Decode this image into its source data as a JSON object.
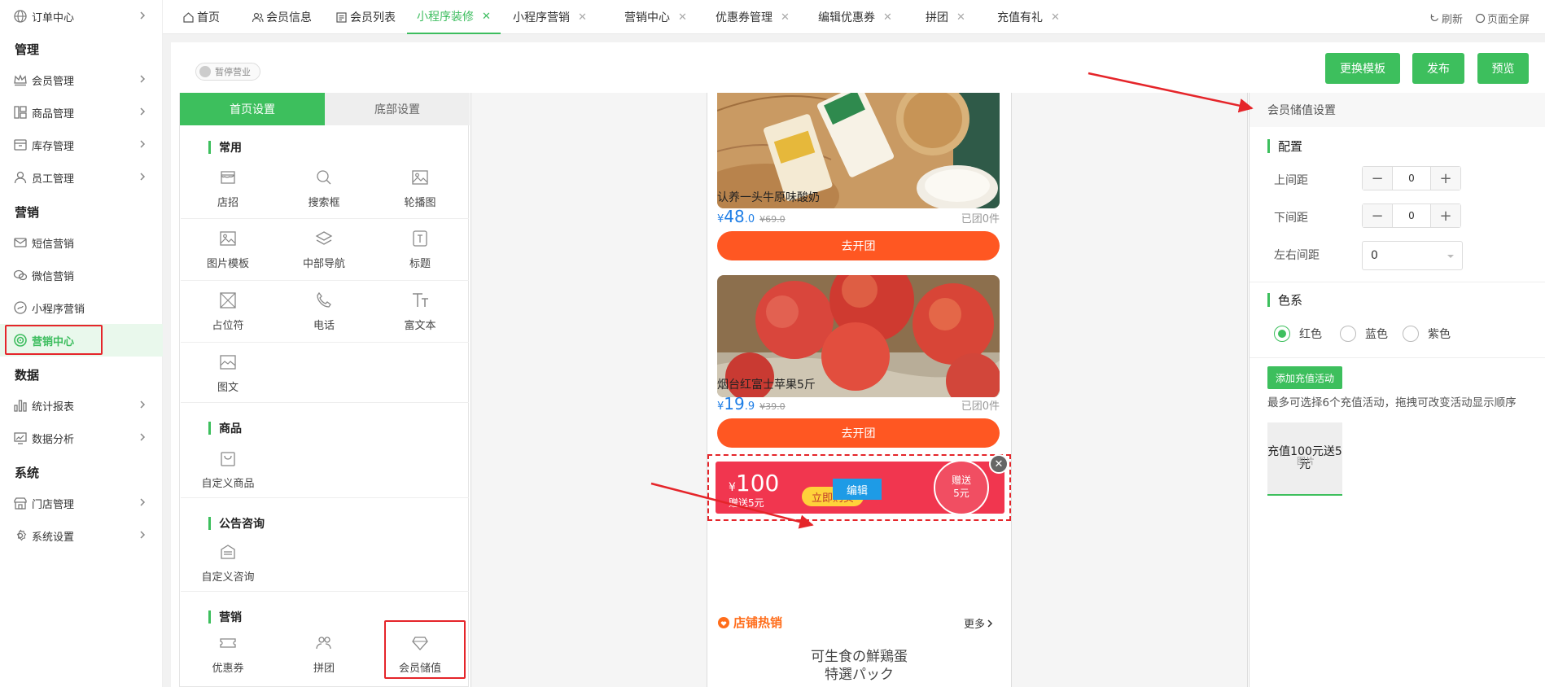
{
  "sidebar": {
    "top_item": "订单中心",
    "groups": [
      "管理",
      "营销",
      "数据",
      "系统"
    ],
    "items": [
      "会员管理",
      "商品管理",
      "库存管理",
      "员工管理",
      "短信营销",
      "微信营销",
      "小程序营销",
      "营销中心",
      "统计报表",
      "数据分析",
      "门店管理",
      "系统设置"
    ]
  },
  "tabs": [
    "首页",
    "会员信息",
    "会员列表",
    "小程序装修",
    "小程序营销",
    "营销中心",
    "优惠券管理",
    "编辑优惠券",
    "拼团",
    "充值有礼"
  ],
  "top_actions": {
    "refresh": "刷新",
    "fullscreen": "页面全屏"
  },
  "toolbar": {
    "status_toggle": "暂停营业",
    "change_template": "更换模板",
    "publish": "发布",
    "preview": "预览"
  },
  "left_panel": {
    "tab_home": "首页设置",
    "tab_bottom": "底部设置",
    "sections": {
      "common": {
        "title": "常用",
        "items": [
          "店招",
          "搜索框",
          "轮播图",
          "图片模板",
          "中部导航",
          "标题",
          "占位符",
          "电话",
          "富文本",
          "图文"
        ]
      },
      "goods": {
        "title": "商品",
        "items": [
          "自定义商品"
        ]
      },
      "notice": {
        "title": "公告咨询",
        "items": [
          "自定义咨询"
        ]
      },
      "marketing": {
        "title": "营销",
        "items": [
          "优惠券",
          "拼团",
          "会员储值"
        ]
      }
    }
  },
  "phone": {
    "products": [
      {
        "name": "认养一头牛原味酸奶",
        "currency": "¥",
        "price_int": "48",
        "price_dec": ".0",
        "old_price": "¥69.0",
        "grouped": "已团0件",
        "button": "去开团"
      },
      {
        "name": "烟台红富士苹果5斤",
        "currency": "¥",
        "price_int": "19",
        "price_dec": ".9",
        "old_price": "¥39.0",
        "grouped": "已团0件",
        "button": "去开团"
      }
    ],
    "recharge_card": {
      "currency": "¥",
      "amount": "100",
      "gift": "赠送5元",
      "cta": "立即购买",
      "edit": "编辑",
      "badge_top": "赠送",
      "badge_bottom": "5元"
    },
    "hot": {
      "title": "店铺热销",
      "more": "更多",
      "jp_line1": "可生食の鮮鶏蛋",
      "jp_line2": "特選パック"
    }
  },
  "right_panel": {
    "header": "会员储值设置",
    "config_title": "配置",
    "top_margin_label": "上间距",
    "top_margin_value": "0",
    "bottom_margin_label": "下间距",
    "bottom_margin_value": "0",
    "side_margin_label": "左右间距",
    "side_margin_value": "0",
    "color_title": "色系",
    "colors": [
      "红色",
      "蓝色",
      "紫色"
    ],
    "selected_color": "红色",
    "add_button": "添加充值活动",
    "hint": "最多可选择6个充值活动，拖拽可改变活动显示顺序",
    "card_text": "充值100元送5元",
    "card_overlay": "图片"
  },
  "colors": {
    "brand_green": "#3dbf5d",
    "orange": "#ff5722",
    "red_card": "#f1364f",
    "annotation_red": "#e5252a",
    "price_blue": "#1e7ee6"
  }
}
